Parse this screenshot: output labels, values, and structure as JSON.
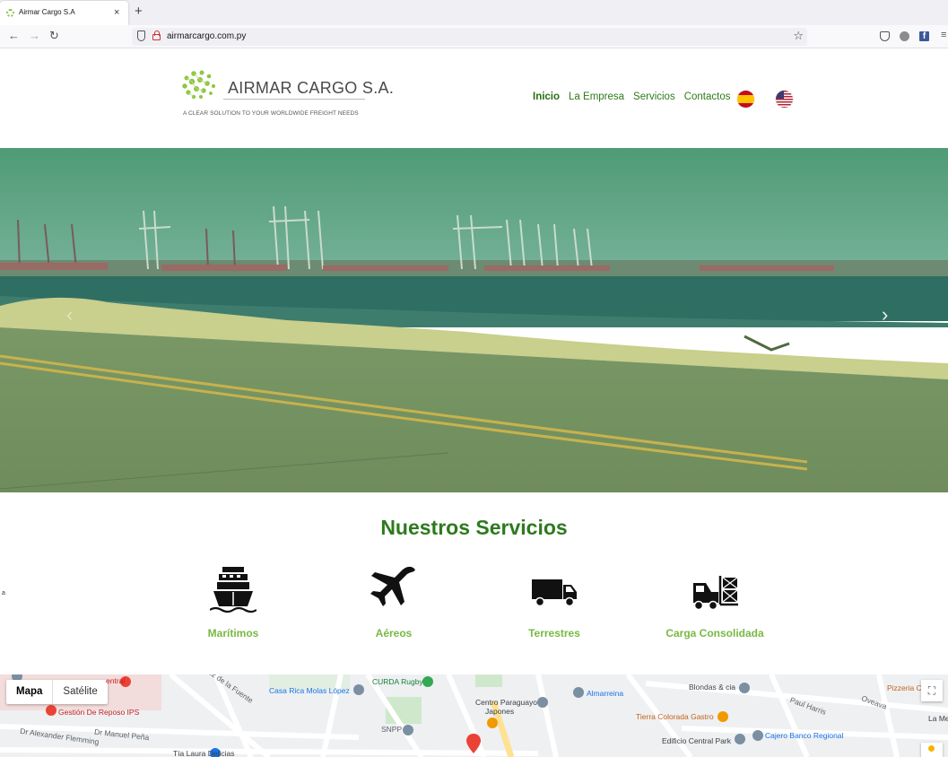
{
  "browser": {
    "tab_title": "Airmar Cargo S.A",
    "tab_close": "×",
    "new_tab": "+",
    "back": "←",
    "forward": "→",
    "reload": "↻",
    "url": "airmarcargo.com.py",
    "bookmark_star": "☆",
    "menu": "≡",
    "facebook_glyph": "f"
  },
  "header": {
    "logo_name": "AIRMAR CARGO S.A.",
    "tagline": "A CLEAR SOLUTION TO YOUR WORLDWIDE FREIGHT NEEDS",
    "nav": [
      {
        "label": "Inicio",
        "active": true
      },
      {
        "label": "La Empresa",
        "active": false
      },
      {
        "label": "Servicios",
        "active": false
      },
      {
        "label": "Contactos",
        "active": false
      }
    ],
    "languages": [
      "es-flag-icon",
      "us-flag-icon"
    ]
  },
  "hero": {
    "prev_glyph": "‹",
    "next_glyph": "›",
    "slide_index": 1
  },
  "services": {
    "title": "Nuestros Servicios",
    "items": [
      {
        "label": "Marítimos",
        "icon": "ship-icon"
      },
      {
        "label": "Aéreos",
        "icon": "airplane-icon"
      },
      {
        "label": "Terrestres",
        "icon": "truck-icon"
      },
      {
        "label": "Carga Consolidada",
        "icon": "forklift-icon"
      }
    ]
  },
  "stray_text": "a",
  "map": {
    "map_type": [
      "Mapa",
      "Satélite"
    ],
    "fullscreen_glyph": "⛶",
    "labels": {
      "gestion": "Gestión De Reposo IPS",
      "central": "entral",
      "alexander": "Dr Alexander Flemming",
      "manuel": "Dr Manuel Peña",
      "tia_laura": "Tía Laura Delicias",
      "casa_rica": "Casa Rica Molas López",
      "curda": "CURDA Rugby",
      "snpp": "SNPP",
      "centro": "Centro Paraguayo",
      "japones": "Japones",
      "almarreina": "Almarreina",
      "blondas": "Blondas & cia",
      "tierra": "Tierra Colorada Gastro",
      "central_park": "Edificio Central Park",
      "cajero": "Cajero Banco Regional",
      "pizzeria": "Pizzeria C",
      "la_mec": "La Mec",
      "fuente": "ez de la Fuente",
      "ovetaya": "Oveava",
      "paul": "Paul Harris"
    }
  },
  "colors": {
    "brand_green": "#2d7a1e",
    "service_green": "#79b843",
    "hero_tint": "#4f9b70"
  }
}
